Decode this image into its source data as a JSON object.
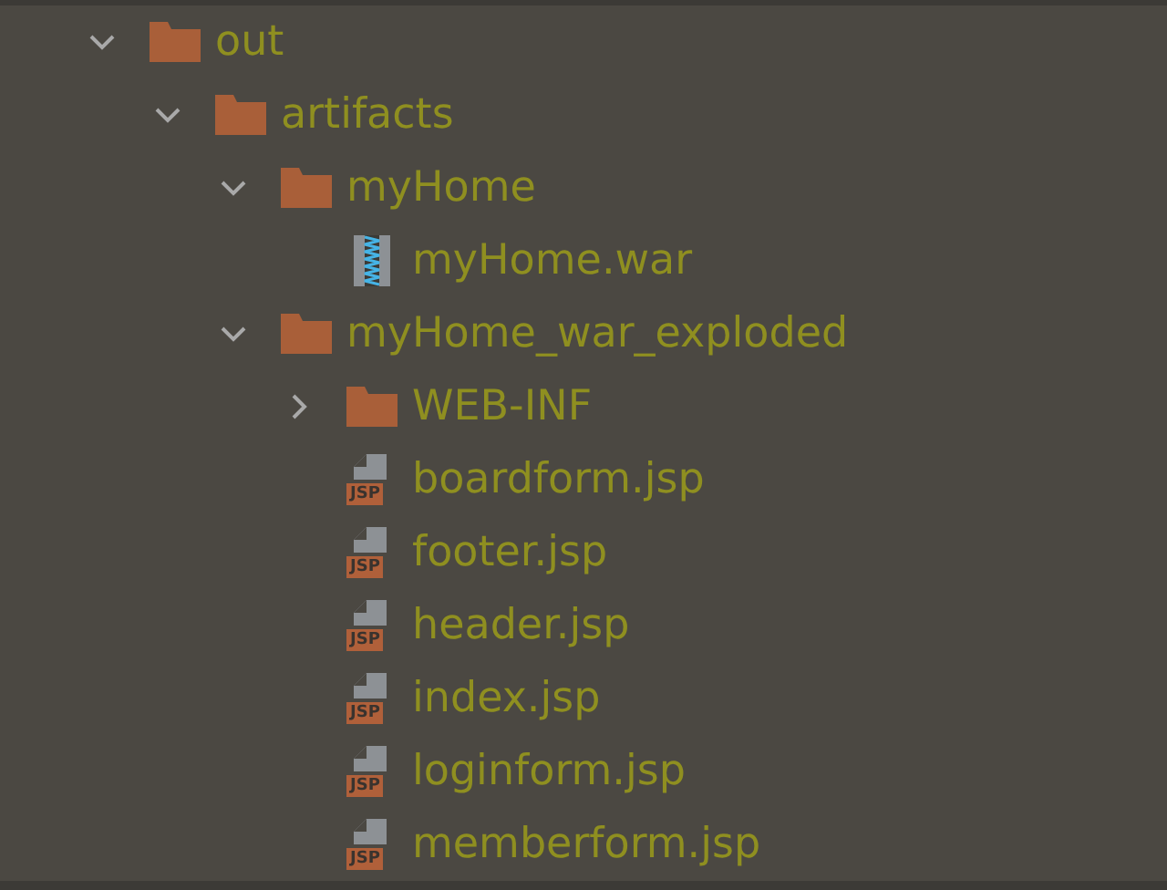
{
  "tree": [
    {
      "kind": "folder",
      "label": "out",
      "expanded": true,
      "children": [
        {
          "kind": "folder",
          "label": "artifacts",
          "expanded": true,
          "children": [
            {
              "kind": "folder",
              "label": "myHome",
              "expanded": true,
              "children": [
                {
                  "kind": "archive",
                  "label": "myHome.war"
                }
              ]
            },
            {
              "kind": "folder",
              "label": "myHome_war_exploded",
              "expanded": true,
              "children": [
                {
                  "kind": "folder",
                  "label": "WEB-INF",
                  "expanded": false
                },
                {
                  "kind": "jsp",
                  "label": "boardform.jsp",
                  "badge": "JSP"
                },
                {
                  "kind": "jsp",
                  "label": "footer.jsp",
                  "badge": "JSP"
                },
                {
                  "kind": "jsp",
                  "label": "header.jsp",
                  "badge": "JSP"
                },
                {
                  "kind": "jsp",
                  "label": "index.jsp",
                  "badge": "JSP"
                },
                {
                  "kind": "jsp",
                  "label": "loginform.jsp",
                  "badge": "JSP"
                },
                {
                  "kind": "jsp",
                  "label": "memberform.jsp",
                  "badge": "JSP"
                }
              ]
            }
          ]
        }
      ]
    }
  ]
}
